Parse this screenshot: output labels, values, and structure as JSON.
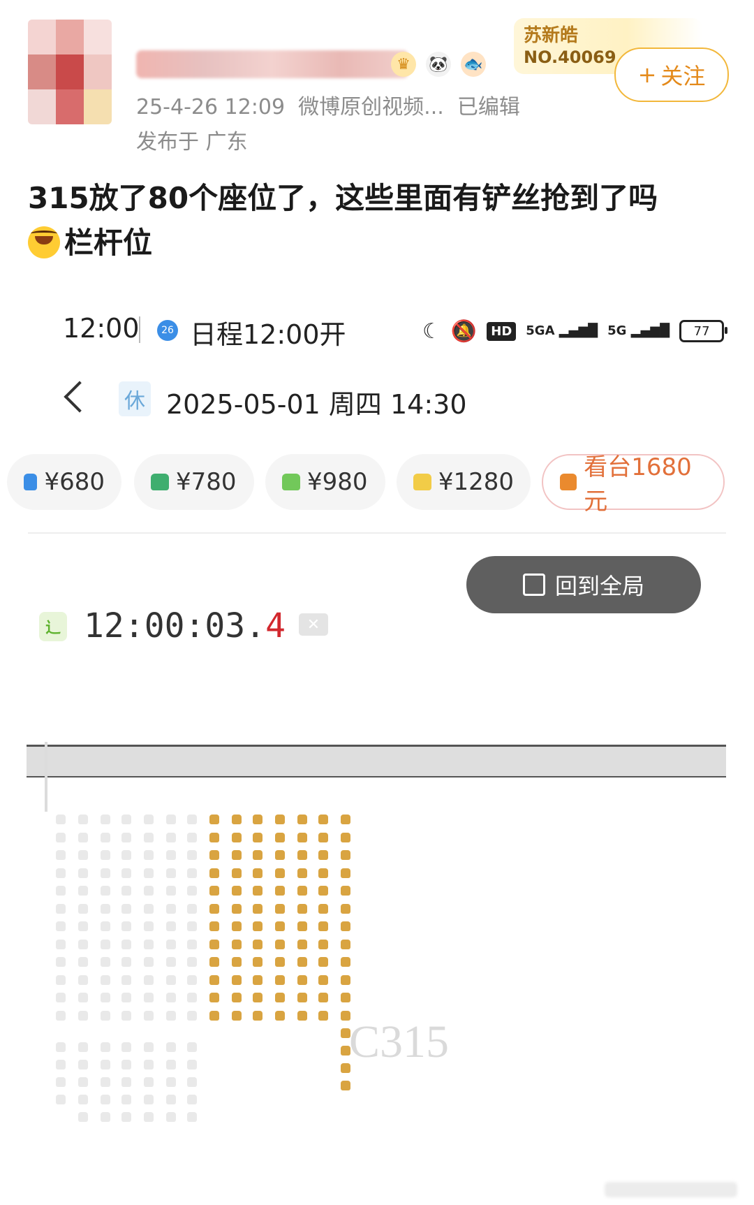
{
  "post": {
    "time": "25-4-26 12:09",
    "source": "微博原创视频...",
    "edited": "已编辑",
    "location": "发布于 广东",
    "text_line1": "315放了80个座位了，这些里面有铲丝抢到了吗",
    "text_line2": "栏杆位",
    "fan_badge_name": "苏新皓",
    "fan_badge_no": "NO.40069",
    "follow_label": "关注",
    "follow_plus": "+"
  },
  "screenshot": {
    "status_time": "12:00",
    "calendar_day": "26",
    "schedule": "日程12:00开",
    "battery": "77",
    "net1": "5GA",
    "net2": "5G",
    "hd": "HD",
    "rest_tag": "休",
    "show_date": "2025-05-01  周四 14:30",
    "prices": [
      {
        "label": "¥680",
        "color": "#3b8ee6"
      },
      {
        "label": "¥780",
        "color": "#3fae6f"
      },
      {
        "label": "¥980",
        "color": "#72c85a"
      },
      {
        "label": "¥1280",
        "color": "#f2cc47"
      },
      {
        "label": "看台1680元",
        "color": "#ea8a2e"
      }
    ],
    "overview_label": "回到全局",
    "timer_main": "12:00:03.",
    "timer_last": "4",
    "timer_icon": "⻌",
    "section": "C315"
  },
  "colors": {
    "available_seat": "#d9a441",
    "unavailable_seat": "#e9e9e9"
  }
}
